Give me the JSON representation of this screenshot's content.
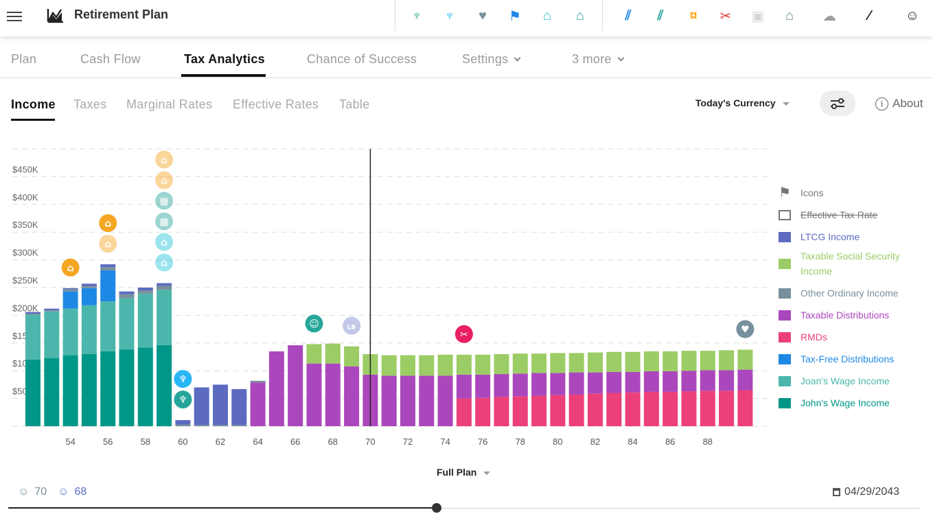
{
  "app": {
    "title": "Retirement Plan"
  },
  "toolbar": {
    "icons": [
      {
        "name": "palm-tree-icon",
        "glyph": "♆",
        "color": "#26a69a"
      },
      {
        "name": "palm-tree-icon",
        "glyph": "♆",
        "color": "#29b6f6"
      },
      {
        "name": "heart-pulse-icon",
        "glyph": "♥",
        "color": "#78909c"
      },
      {
        "name": "flag-icon",
        "glyph": "⚑",
        "color": "#1e88e5"
      },
      {
        "name": "graduation-cap-icon",
        "glyph": "⌂",
        "color": "#26c6da"
      },
      {
        "name": "graduation-cap-icon",
        "glyph": "⌂",
        "color": "#26a69a"
      },
      {
        "name": "chart-growth-icon",
        "glyph": "⫽",
        "color": "#1e88e5"
      },
      {
        "name": "chart-growth-icon",
        "glyph": "⫽",
        "color": "#26a69a"
      },
      {
        "name": "money-cancel-icon",
        "glyph": "¤",
        "color": "#ffa726"
      },
      {
        "name": "scissors-cut-icon",
        "glyph": "✂",
        "color": "#e53935"
      },
      {
        "name": "certificate-icon",
        "glyph": "▣",
        "color": "#d6d6d6"
      },
      {
        "name": "bank-transfer-icon",
        "glyph": "⌂",
        "color": "#607d8b"
      },
      {
        "name": "cloud-check-icon",
        "glyph": "☁",
        "color": "#9e9e9e"
      },
      {
        "name": "sleep-off-icon",
        "glyph": "⁄",
        "color": "#222222"
      },
      {
        "name": "face-avatar-icon",
        "glyph": "☺",
        "color": "#222222"
      }
    ]
  },
  "tabs": [
    {
      "label": "Plan"
    },
    {
      "label": "Cash Flow"
    },
    {
      "label": "Tax Analytics",
      "active": true
    },
    {
      "label": "Chance of Success"
    },
    {
      "label": "Settings"
    },
    {
      "label": "3 more"
    }
  ],
  "subtabs": [
    {
      "label": "Income",
      "active": true
    },
    {
      "label": "Taxes"
    },
    {
      "label": "Marginal Rates"
    },
    {
      "label": "Effective Rates"
    },
    {
      "label": "Table"
    }
  ],
  "currency": {
    "selected": "Today's Currency"
  },
  "about": {
    "label": "About"
  },
  "legend": [
    {
      "label": "Icons",
      "type": "flag",
      "color": "#757575"
    },
    {
      "label": "Effective Tax Rate",
      "type": "outline",
      "color": "#757575",
      "disabled": true
    },
    {
      "label": "LTCG Income",
      "color": "#5c6bc0"
    },
    {
      "label": "Taxable Social Security Income",
      "color": "#9ccc65"
    },
    {
      "label": "Other Ordinary Income",
      "color": "#78909c"
    },
    {
      "label": "Taxable Distributions",
      "color": "#ab47bc"
    },
    {
      "label": "RMDs",
      "color": "#ec407a"
    },
    {
      "label": "Tax-Free Distributions",
      "color": "#1e88e5"
    },
    {
      "label": "Joan's Wage Income",
      "color": "#4db6ac"
    },
    {
      "label": "John's Wage Income",
      "color": "#009688"
    }
  ],
  "chart_data": {
    "type": "bar",
    "stacked": true,
    "ages": [
      52,
      53,
      54,
      55,
      56,
      57,
      58,
      59,
      60,
      61,
      62,
      63,
      64,
      65,
      66,
      67,
      68,
      69,
      70,
      71,
      72,
      73,
      74,
      75,
      76,
      77,
      78,
      79,
      80,
      81,
      82,
      83,
      84,
      85,
      86,
      87,
      88,
      89,
      90
    ],
    "x_tick_labels": [
      "54",
      "56",
      "58",
      "60",
      "62",
      "64",
      "66",
      "68",
      "70",
      "72",
      "74",
      "76",
      "78",
      "80",
      "82",
      "84",
      "86",
      "88"
    ],
    "y_tick_labels": [
      "$50K",
      "$100K",
      "$150K",
      "$200K",
      "$250K",
      "$300K",
      "$350K",
      "$400K",
      "$450K"
    ],
    "ylim": [
      0,
      500
    ],
    "unit": "thousands USD",
    "grid": true,
    "legend_position": "right",
    "current_age_marker": 70,
    "series": [
      {
        "name": "John's Wage Income",
        "color": "#009688",
        "values": [
          120,
          123,
          128,
          130,
          135,
          138,
          142,
          146,
          0,
          0,
          0,
          0,
          0,
          0,
          0,
          0,
          0,
          0,
          0,
          0,
          0,
          0,
          0,
          0,
          0,
          0,
          0,
          0,
          0,
          0,
          0,
          0,
          0,
          0,
          0,
          0,
          0,
          0,
          0
        ]
      },
      {
        "name": "Joan's Wage Income",
        "color": "#4db6ac",
        "values": [
          81,
          84,
          84,
          88,
          90,
          93,
          97,
          100,
          0,
          0,
          0,
          0,
          0,
          0,
          0,
          0,
          0,
          0,
          0,
          0,
          0,
          0,
          0,
          0,
          0,
          0,
          0,
          0,
          0,
          0,
          0,
          0,
          0,
          0,
          0,
          0,
          0,
          0,
          0
        ]
      },
      {
        "name": "Tax-Free Distributions",
        "color": "#1e88e5",
        "values": [
          0,
          0,
          31,
          31,
          56,
          0,
          0,
          0,
          0,
          0,
          0,
          0,
          0,
          0,
          0,
          0,
          0,
          0,
          0,
          0,
          0,
          0,
          0,
          0,
          0,
          0,
          0,
          0,
          0,
          0,
          0,
          0,
          0,
          0,
          0,
          0,
          0,
          0,
          0
        ]
      },
      {
        "name": "RMDs",
        "color": "#ec407a",
        "values": [
          0,
          0,
          0,
          0,
          0,
          0,
          0,
          0,
          0,
          0,
          0,
          0,
          0,
          0,
          0,
          0,
          0,
          0,
          0,
          0,
          0,
          0,
          0,
          50,
          51,
          53,
          54,
          55,
          56,
          57,
          59,
          60,
          61,
          62,
          62,
          63,
          64,
          64,
          65
        ]
      },
      {
        "name": "Taxable Distributions",
        "color": "#ab47bc",
        "values": [
          0,
          0,
          0,
          0,
          0,
          0,
          0,
          0,
          0,
          0,
          0,
          0,
          79,
          135,
          146,
          113,
          113,
          108,
          93,
          91,
          91,
          91,
          91,
          43,
          42,
          41,
          41,
          41,
          40,
          40,
          38,
          38,
          37,
          37,
          37,
          37,
          37,
          37,
          37
        ]
      },
      {
        "name": "Other Ordinary Income",
        "color": "#78909c",
        "values": [
          2,
          2,
          4,
          4,
          6,
          7,
          6,
          7,
          3,
          2,
          2,
          2,
          3,
          0,
          0,
          0,
          0,
          0,
          0,
          0,
          0,
          0,
          0,
          0,
          0,
          0,
          0,
          0,
          0,
          0,
          0,
          0,
          0,
          0,
          0,
          0,
          0,
          0,
          0
        ]
      },
      {
        "name": "LTCG Income",
        "color": "#5c6bc0",
        "values": [
          3,
          3,
          2,
          4,
          5,
          5,
          5,
          5,
          8,
          68,
          73,
          65,
          0,
          0,
          0,
          0,
          0,
          0,
          0,
          0,
          0,
          0,
          0,
          0,
          0,
          0,
          0,
          0,
          0,
          0,
          0,
          0,
          0,
          0,
          0,
          0,
          0,
          0,
          0
        ]
      },
      {
        "name": "Taxable Social Security Income",
        "color": "#9ccc65",
        "values": [
          0,
          0,
          0,
          0,
          0,
          0,
          0,
          0,
          0,
          0,
          0,
          0,
          0,
          0,
          0,
          35,
          36,
          36,
          37,
          37,
          37,
          37,
          38,
          36,
          36,
          36,
          36,
          35,
          36,
          35,
          36,
          36,
          36,
          36,
          36,
          36,
          35,
          36,
          36
        ]
      }
    ],
    "event_icons": [
      {
        "age": 54,
        "icons": [
          {
            "name": "graduation-cap-icon",
            "glyph": "⌂",
            "color": "#f5a623"
          }
        ]
      },
      {
        "age": 56,
        "icons": [
          {
            "name": "graduation-cap-icon",
            "glyph": "⌂",
            "color": "#f5a623",
            "faded": true
          },
          {
            "name": "graduation-cap-icon",
            "glyph": "⌂",
            "color": "#f5a623"
          }
        ]
      },
      {
        "age": 59,
        "icons": [
          {
            "name": "graduation-cap-icon",
            "glyph": "⌂",
            "color": "#26c6da",
            "faded": true
          },
          {
            "name": "graduation-cap-icon",
            "glyph": "⌂",
            "color": "#26c6da",
            "faded": true
          },
          {
            "name": "building-icon",
            "glyph": "▦",
            "color": "#26a69a",
            "faded": true
          },
          {
            "name": "building-icon",
            "glyph": "▦",
            "color": "#26a69a",
            "faded": true
          },
          {
            "name": "graduation-cap-icon",
            "glyph": "⌂",
            "color": "#f5a623",
            "faded": true
          },
          {
            "name": "graduation-cap-icon",
            "glyph": "⌂",
            "color": "#f5a623",
            "faded": true
          }
        ]
      },
      {
        "age": 60,
        "icons": [
          {
            "name": "palm-tree-icon",
            "glyph": "♆",
            "color": "#26a69a"
          },
          {
            "name": "palm-tree-icon",
            "glyph": "♆",
            "color": "#29b6f6"
          }
        ]
      },
      {
        "age": 67,
        "icons": [
          {
            "name": "social-security-icon",
            "glyph": "☺",
            "color": "#26a69a"
          }
        ]
      },
      {
        "age": 69,
        "icons": [
          {
            "name": "weight-icon",
            "glyph": "LB",
            "color": "#7986cb",
            "faded": true
          }
        ]
      },
      {
        "age": 75,
        "icons": [
          {
            "name": "scissors-cut-icon",
            "glyph": "✂",
            "color": "#e91e63"
          }
        ]
      },
      {
        "age": 90,
        "icons": [
          {
            "name": "heart-pulse-icon",
            "glyph": "♥",
            "color": "#78909c"
          }
        ]
      }
    ]
  },
  "timeline": {
    "range": "Full Plan",
    "ages": [
      {
        "value": "70",
        "color": "#78909c"
      },
      {
        "value": "68",
        "color": "#5c6bc0"
      }
    ],
    "date": "04/29/2043",
    "progress": 0.47
  }
}
